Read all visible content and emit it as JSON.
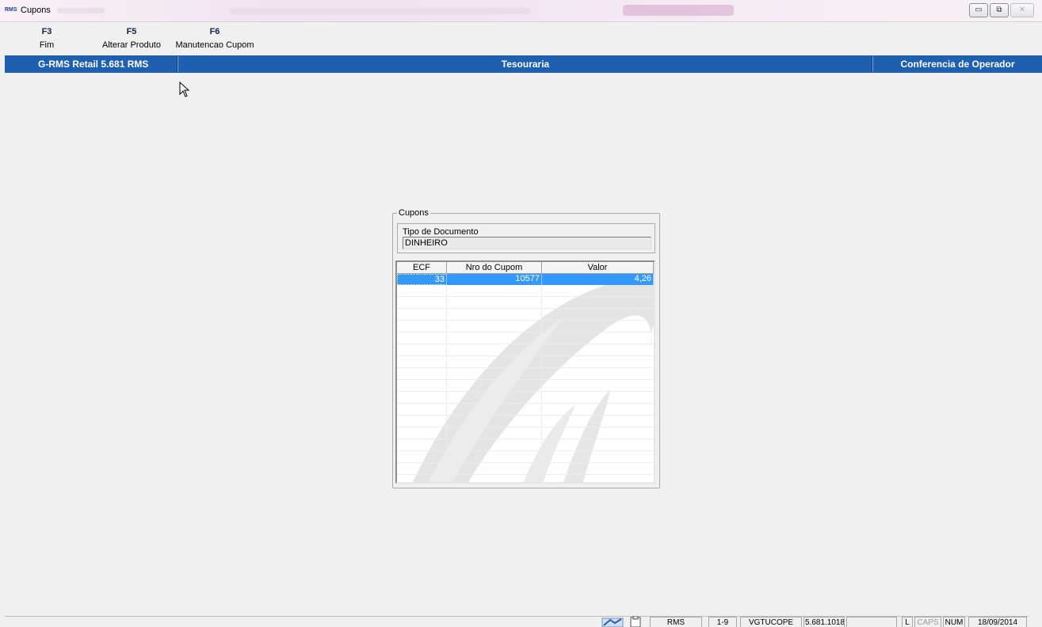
{
  "window": {
    "icon_text": "RMS",
    "title": "Cupons",
    "controls": {
      "minimize": "▭",
      "restore": "⧉",
      "close": "✕"
    }
  },
  "toolbar": {
    "keys": [
      {
        "key": "F3",
        "label": "Fim"
      },
      {
        "key": "F5",
        "label": "Alterar Produto"
      },
      {
        "key": "F6",
        "label": "Manutencao Cupom"
      }
    ]
  },
  "header": {
    "app_name": "G-RMS Retail 5.681 RMS",
    "module": "Tesouraria",
    "screen": "Conferencia de Operador"
  },
  "cupons_group": {
    "legend": "Cupons",
    "tipo_documento": {
      "label": "Tipo de Documento",
      "value": "DINHEIRO"
    },
    "grid": {
      "columns": [
        "ECF",
        "Nro do Cupom",
        "Valor"
      ],
      "rows": [
        {
          "ecf": "33",
          "nro_cupom": "10577",
          "valor": "4,26"
        }
      ]
    }
  },
  "statusbar": {
    "panels": {
      "system": "RMS",
      "range": "1-9",
      "program": "VGTUCOPE",
      "version": "5.681.1018",
      "empty": "",
      "l": "L",
      "caps": "CAPS",
      "num": "NUM",
      "date": "18/09/2014"
    }
  },
  "colors": {
    "header_blue": "#1f5fb0",
    "selection_blue": "#3399ff",
    "background": "#f0f0f0"
  }
}
